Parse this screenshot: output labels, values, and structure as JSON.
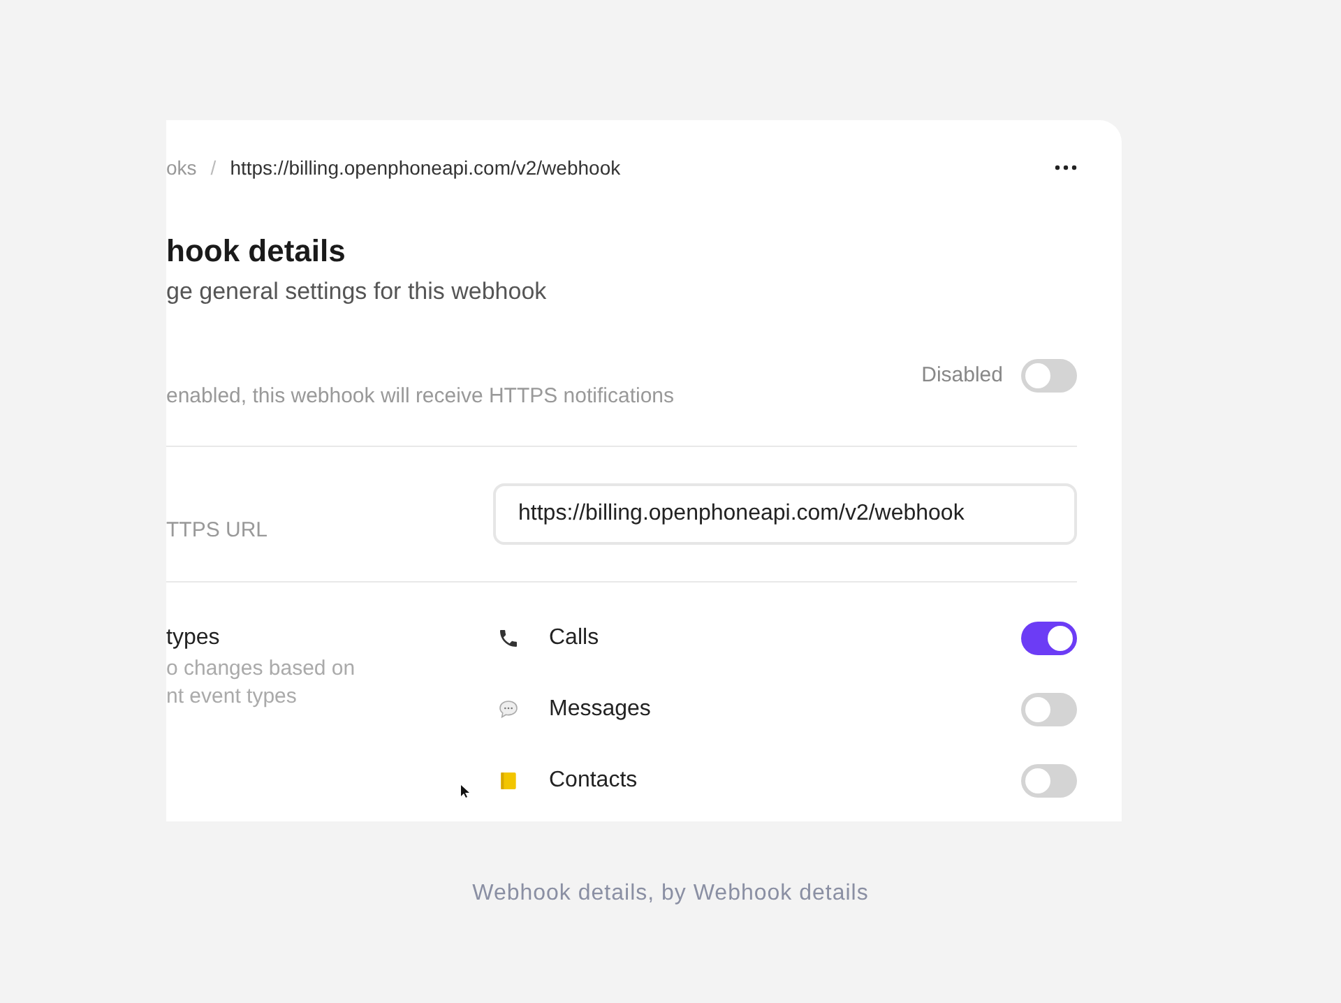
{
  "breadcrumb": {
    "parent": "oks",
    "separator": "/",
    "current": "https://billing.openphoneapi.com/v2/webhook"
  },
  "header": {
    "title": "hook details",
    "subtitle": "ge general settings for this webhook"
  },
  "status": {
    "description": "enabled, this webhook will receive HTTPS notifications",
    "label": "Disabled",
    "on": false
  },
  "url_field": {
    "label": "TTPS URL",
    "value": "https://billing.openphoneapi.com/v2/webhook"
  },
  "event_types": {
    "title": "types",
    "description_lines": [
      "o changes based on",
      "nt event types"
    ],
    "items": [
      {
        "kind": "phone",
        "label": "Calls",
        "on": true
      },
      {
        "kind": "message",
        "label": "Messages",
        "on": false
      },
      {
        "kind": "contact",
        "label": "Contacts",
        "on": false
      }
    ]
  },
  "caption": "Webhook details, by Webhook details"
}
